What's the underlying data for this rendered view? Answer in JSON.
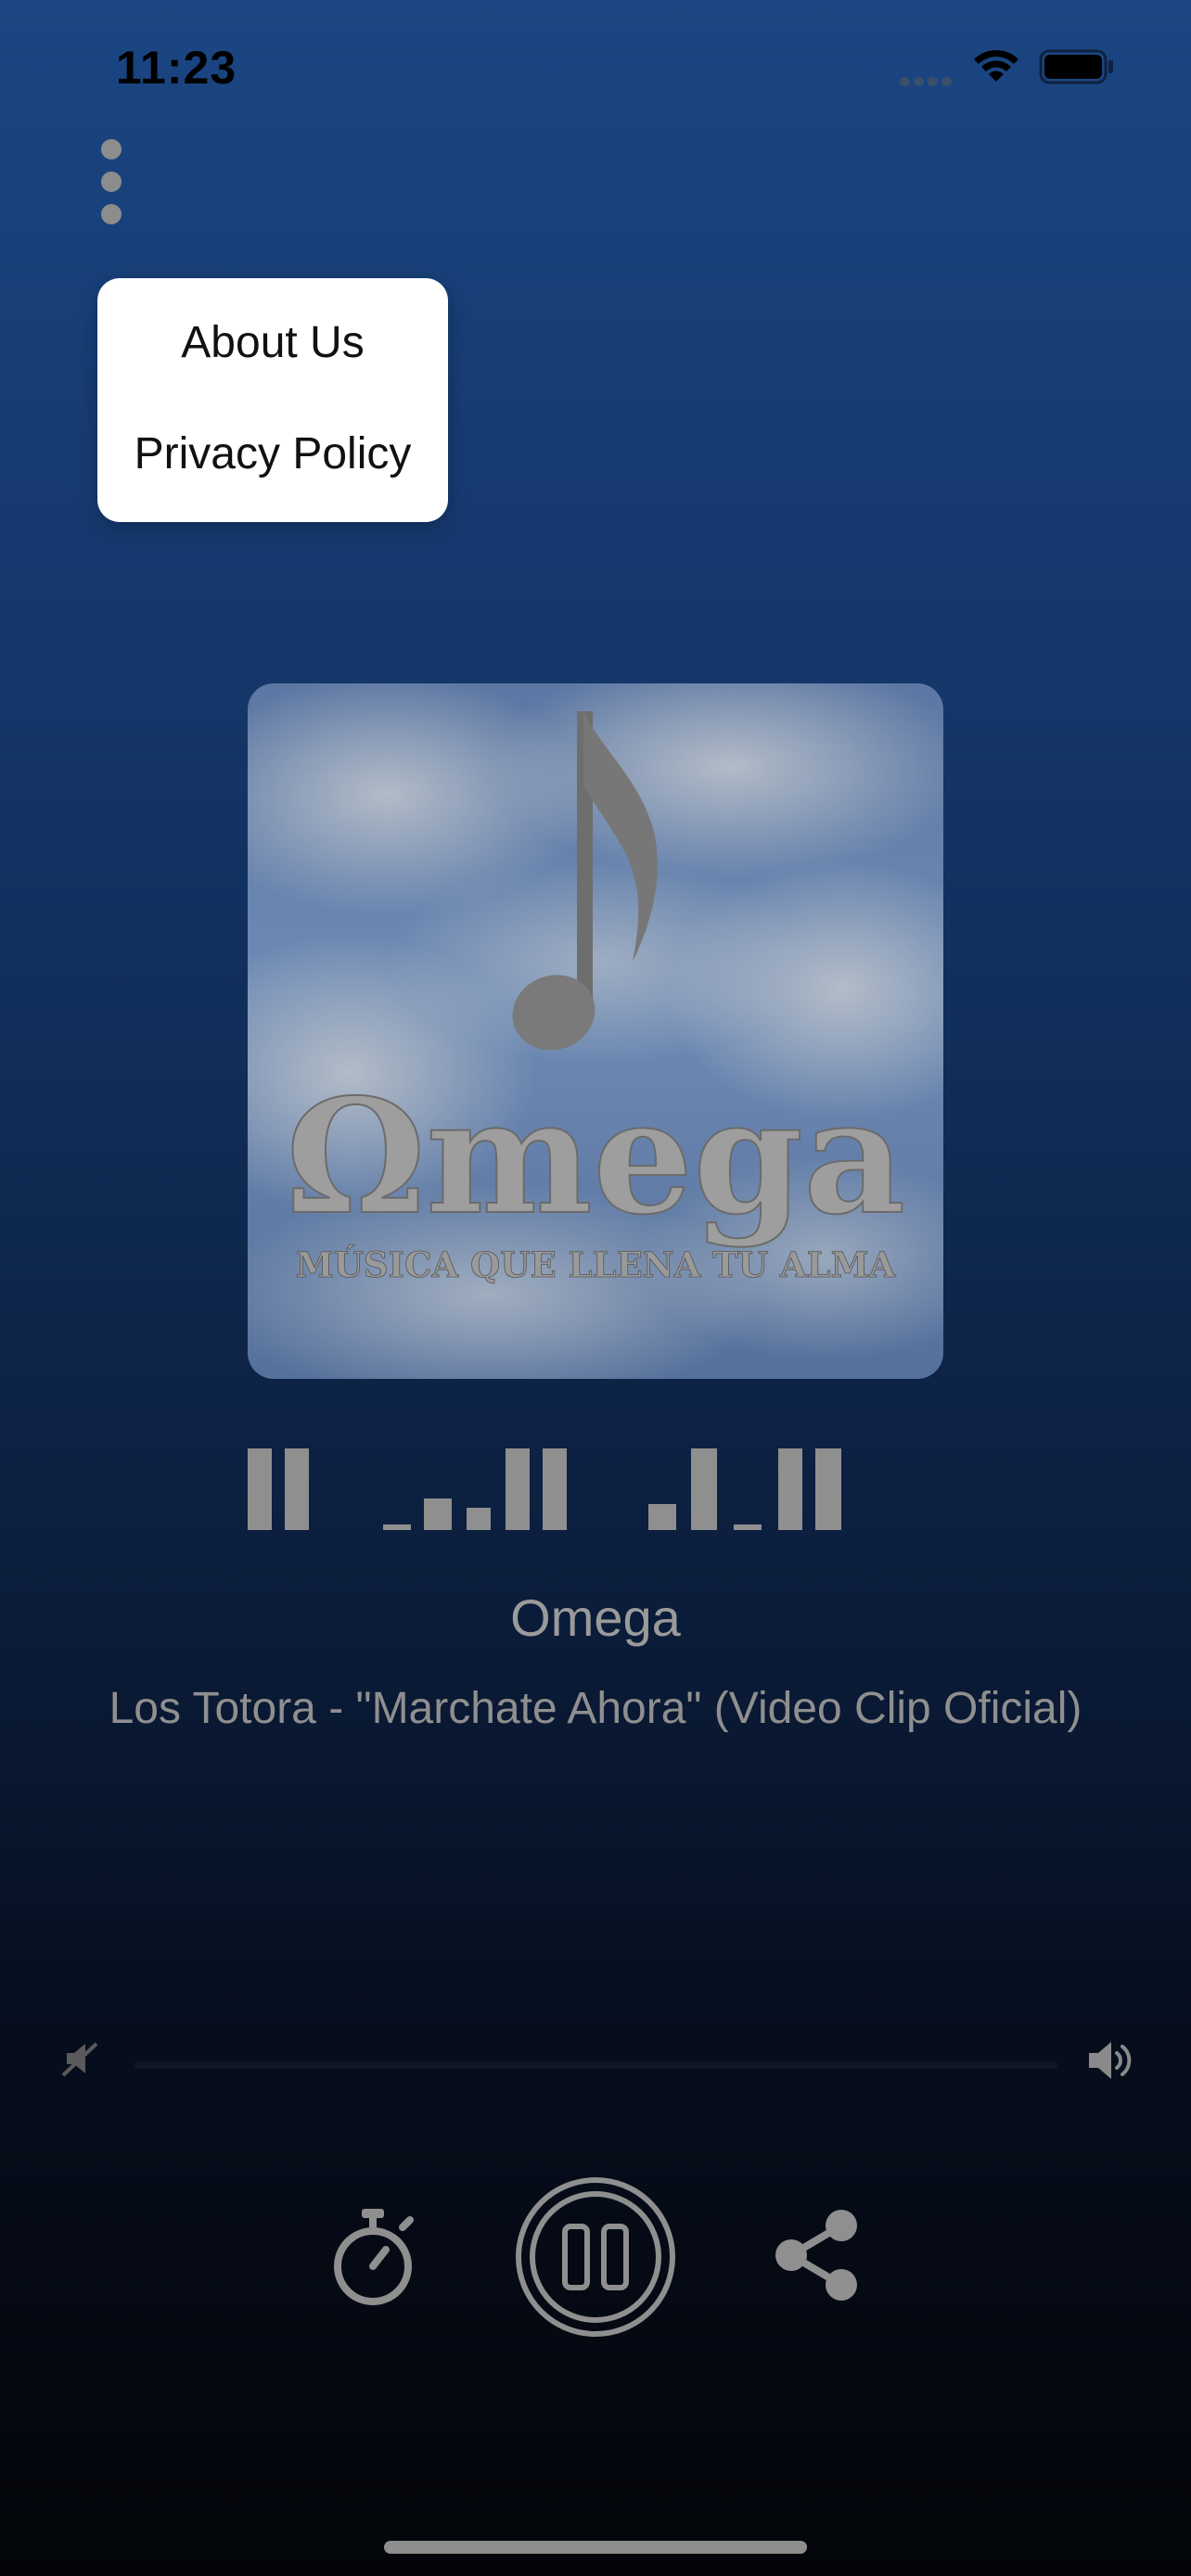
{
  "status_bar": {
    "time": "11:23"
  },
  "menu": {
    "items": [
      {
        "label": "About Us"
      },
      {
        "label": "Privacy Policy"
      }
    ]
  },
  "artwork": {
    "logo_text": "Ωmega",
    "tagline": "MÚSICA QUE LLENA TU ALMA"
  },
  "now_playing": {
    "station": "Omega",
    "song": "Los Totora - \"Marchate Ahora\" (Video Clip Oficial)"
  },
  "player": {
    "volume_level": 0,
    "state": "playing"
  },
  "colors": {
    "background_top": "#1b4683",
    "background_bottom": "#030509",
    "control_gray": "#9b9b9b",
    "menu_background": "#ffffff"
  },
  "icons": {
    "menu": "kebab-menu-icon",
    "volume_min": "volume-mute-icon",
    "volume_max": "volume-high-icon",
    "timer": "stopwatch-icon",
    "play_pause": "pause-icon",
    "share": "share-icon"
  }
}
